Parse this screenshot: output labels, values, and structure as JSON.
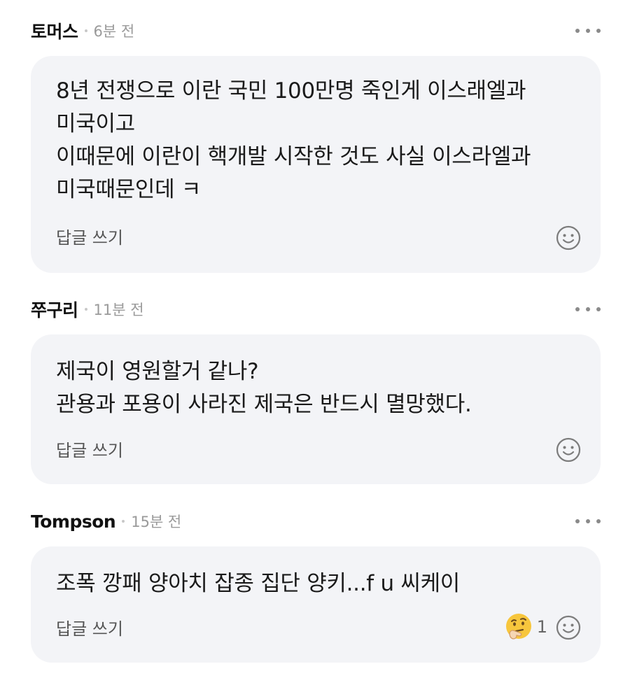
{
  "comments": [
    {
      "author": "토머스",
      "time": "6분 전",
      "text": "8년 전쟁으로 이란 국민 100만명 죽인게 이스래엘과\n미국이고\n이때문에 이란이 핵개발 시작한 것도 사실 이스라엘과\n미국때문인데 ㅋ",
      "reply_label": "답글 쓰기"
    },
    {
      "author": "쭈구리",
      "time": "11분 전",
      "text": "제국이 영원할거 같나?\n관용과 포용이 사라진 제국은 반드시 멸망했다.",
      "reply_label": "답글 쓰기"
    },
    {
      "author": "Tompson",
      "time": "15분 전",
      "text": "조폭 깡패 양아치 잡종 집단 양키...f u 씨케이",
      "reply_label": "답글 쓰기",
      "reaction_count": "1",
      "reaction_icon": "thinking-face-icon"
    }
  ],
  "icons": {
    "more": "more-options-icon",
    "react": "smiley-face-icon"
  },
  "colors": {
    "bubble": "#f3f4f7",
    "author": "#111111",
    "time": "#9a9a9a"
  }
}
